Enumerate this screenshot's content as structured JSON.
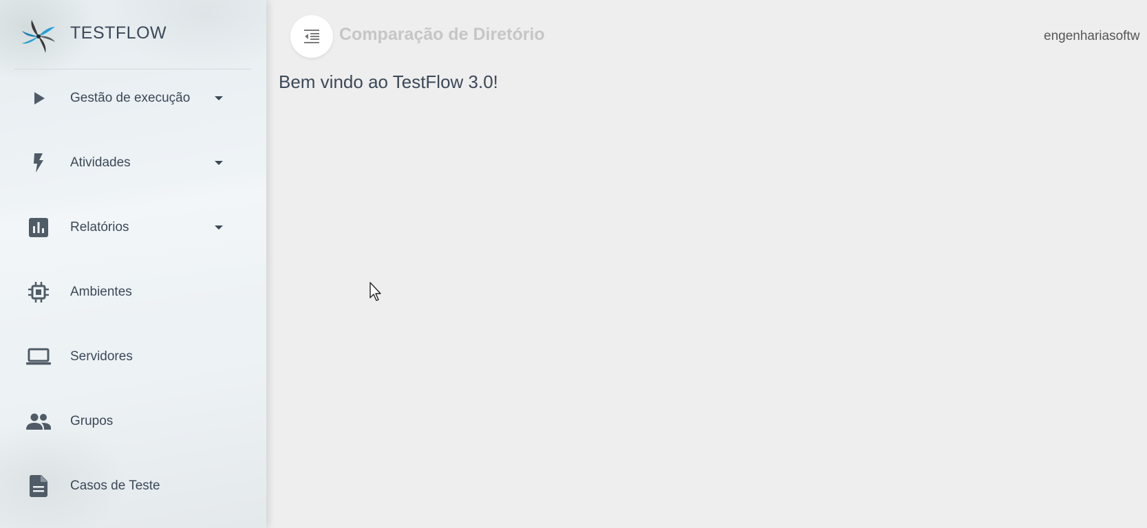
{
  "brand": {
    "name": "TESTFLOW"
  },
  "sidebar": {
    "items": [
      {
        "label": "Gestão de execução",
        "icon": "play-icon",
        "has_dropdown": true
      },
      {
        "label": "Atividades",
        "icon": "bolt-icon",
        "has_dropdown": true
      },
      {
        "label": "Relatórios",
        "icon": "bar-chart-icon",
        "has_dropdown": true
      },
      {
        "label": "Ambientes",
        "icon": "chip-icon",
        "has_dropdown": false
      },
      {
        "label": "Servidores",
        "icon": "laptop-icon",
        "has_dropdown": false
      },
      {
        "label": "Grupos",
        "icon": "people-icon",
        "has_dropdown": false
      },
      {
        "label": "Casos de Teste",
        "icon": "document-icon",
        "has_dropdown": false
      }
    ]
  },
  "header": {
    "title": "Comparação de Diretório",
    "user": "engenhariasoftw",
    "toggle_icon": "menu-collapse-icon"
  },
  "main": {
    "welcome": "Bem vindo ao TestFlow 3.0!"
  },
  "colors": {
    "text": "#3c4858",
    "icon": "#4f5b66",
    "title_faded": "#c6c6c6",
    "background": "#eeeeee"
  }
}
